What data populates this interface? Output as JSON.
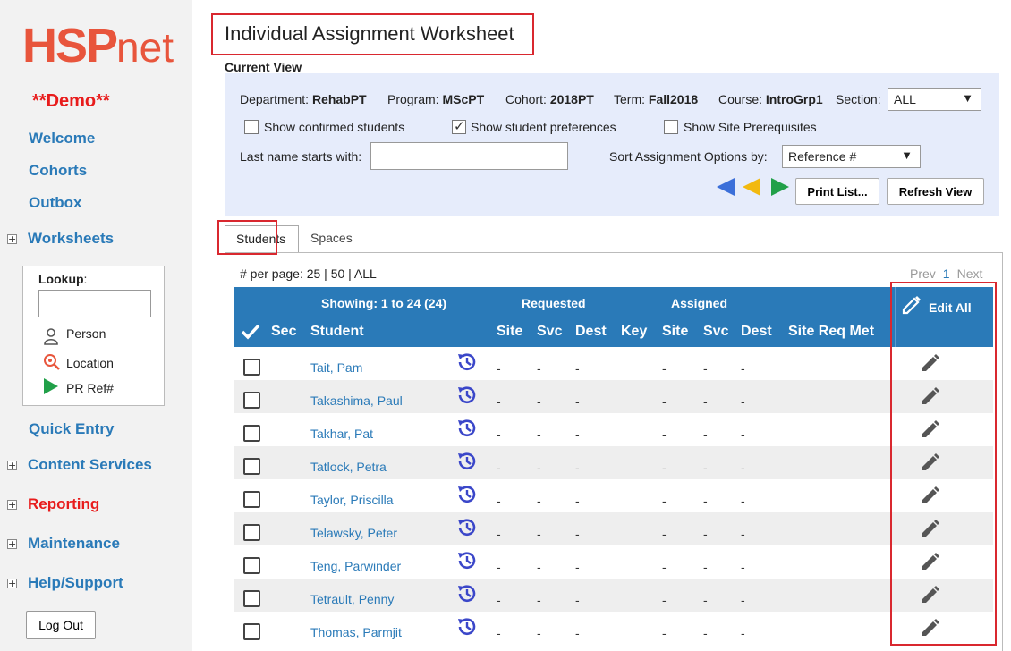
{
  "app": {
    "logo_main": "HSP",
    "logo_sub": "net",
    "demo_label": "**Demo**"
  },
  "sidebar": {
    "nav": [
      {
        "label": "Welcome"
      },
      {
        "label": "Cohorts"
      },
      {
        "label": "Outbox"
      },
      {
        "label": "Worksheets"
      },
      {
        "label": "Quick Entry"
      },
      {
        "label": "Content Services"
      },
      {
        "label": "Reporting"
      },
      {
        "label": "Maintenance"
      },
      {
        "label": "Help/Support"
      }
    ],
    "lookup": {
      "title": "Lookup",
      "input_value": "",
      "options": [
        {
          "label": "Person",
          "icon": "person-icon"
        },
        {
          "label": "Location",
          "icon": "location-icon"
        },
        {
          "label": "PR Ref#",
          "icon": "play-icon"
        }
      ]
    },
    "logout_label": "Log Out"
  },
  "page": {
    "title": "Individual Assignment Worksheet",
    "current_view_label": "Current View"
  },
  "filters": {
    "department_label": "Department:",
    "department_value": "RehabPT",
    "program_label": "Program:",
    "program_value": "MScPT",
    "cohort_label": "Cohort:",
    "cohort_value": "2018PT",
    "term_label": "Term:",
    "term_value": "Fall2018",
    "course_label": "Course:",
    "course_value": "IntroGrp1",
    "section_label": "Section:",
    "section_value": "ALL",
    "show_confirmed_label": "Show confirmed students",
    "show_confirmed_checked": false,
    "show_prefs_label": "Show student preferences",
    "show_prefs_checked": true,
    "show_prereq_label": "Show Site Prerequisites",
    "show_prereq_checked": false,
    "lastname_label": "Last name starts with:",
    "lastname_value": "",
    "sort_label": "Sort Assignment Options by:",
    "sort_value": "Reference #",
    "print_label": "Print List...",
    "refresh_label": "Refresh View",
    "arrow_colors": [
      "#3b6fd9",
      "#f2b90f",
      "#21a049"
    ]
  },
  "tabs": [
    {
      "label": "Students",
      "active": true
    },
    {
      "label": "Spaces",
      "active": false
    }
  ],
  "list": {
    "per_page_label": "# per page: 25 | 50 | ALL",
    "prev_label": "Prev",
    "page_number": "1",
    "next_label": "Next",
    "showing_label": "Showing: 1 to 24 (24)",
    "requested_label": "Requested",
    "assigned_label": "Assigned",
    "edit_all_label": "Edit All",
    "columns": [
      "Sec",
      "Student",
      "Site",
      "Svc",
      "Dest",
      "Key",
      "Site",
      "Svc",
      "Dest",
      "Site Req Met"
    ],
    "rows": [
      {
        "name": "Tait, Pam",
        "cells": [
          "-",
          "-",
          "-",
          "-",
          "-",
          "-"
        ]
      },
      {
        "name": "Takashima, Paul",
        "cells": [
          "-",
          "-",
          "-",
          "-",
          "-",
          "-"
        ]
      },
      {
        "name": "Takhar, Pat",
        "cells": [
          "-",
          "-",
          "-",
          "-",
          "-",
          "-"
        ]
      },
      {
        "name": "Tatlock, Petra",
        "cells": [
          "-",
          "-",
          "-",
          "-",
          "-",
          "-"
        ]
      },
      {
        "name": "Taylor, Priscilla",
        "cells": [
          "-",
          "-",
          "-",
          "-",
          "-",
          "-"
        ]
      },
      {
        "name": "Telawsky, Peter",
        "cells": [
          "-",
          "-",
          "-",
          "-",
          "-",
          "-"
        ]
      },
      {
        "name": "Teng, Parwinder",
        "cells": [
          "-",
          "-",
          "-",
          "-",
          "-",
          "-"
        ]
      },
      {
        "name": "Tetrault, Penny",
        "cells": [
          "-",
          "-",
          "-",
          "-",
          "-",
          "-"
        ]
      },
      {
        "name": "Thomas, Parmjit",
        "cells": [
          "-",
          "-",
          "-",
          "-",
          "-",
          "-"
        ]
      }
    ]
  },
  "colors": {
    "accent_blue": "#2a7ab8",
    "brand_orange": "#e8553c",
    "highlight_red": "#d9282f",
    "history_icon": "#3b47c9"
  }
}
